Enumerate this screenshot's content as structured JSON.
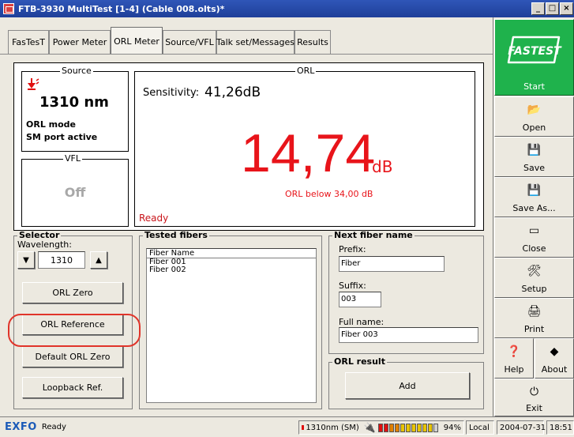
{
  "window": {
    "title": "FTB-3930 MultiTest [1-4] (Cable 008.olts)*",
    "controls": [
      "_",
      "□",
      "×"
    ]
  },
  "tabs": [
    {
      "label": "FasTesT"
    },
    {
      "label": "Power Meter"
    },
    {
      "label": "ORL Meter"
    },
    {
      "label": "Source/VFL"
    },
    {
      "label": "Talk set/Messages"
    },
    {
      "label": "Results"
    }
  ],
  "source": {
    "legend": "Source",
    "wavelength": "1310 nm",
    "mode": "ORL mode",
    "port": "SM port active"
  },
  "vfl": {
    "legend": "VFL",
    "state": "Off"
  },
  "orl": {
    "legend": "ORL",
    "sensitivity_label": "Sensitivity:",
    "sensitivity_value": "41,26dB",
    "value": "14,74",
    "unit": "dB",
    "note": "ORL below 34,00 dB",
    "status": "Ready"
  },
  "selector": {
    "legend": "Selector",
    "wavelength_label": "Wavelength:",
    "wavelength_value": "1310",
    "buttons": {
      "orl_zero": "ORL Zero",
      "orl_reference": "ORL Reference",
      "default_orl_zero": "Default ORL Zero",
      "loopback": "Loopback Ref."
    }
  },
  "tested_fibers": {
    "legend": "Tested fibers",
    "header": "Fiber Name",
    "items": [
      "Fiber 001",
      "Fiber 002"
    ]
  },
  "next_fiber": {
    "legend": "Next fiber name",
    "prefix_label": "Prefix:",
    "prefix_value": "Fiber",
    "suffix_label": "Suffix:",
    "suffix_value": "003",
    "fullname_label": "Full name:",
    "fullname_value": "Fiber 003"
  },
  "orl_result": {
    "legend": "ORL result",
    "add_label": "Add"
  },
  "right_panel": {
    "fastest_logo": "FASTEST",
    "start_label": "Start",
    "open_label": "Open",
    "save_label": "Save",
    "save_as_label": "Save As...",
    "close_label": "Close",
    "setup_label": "Setup",
    "print_label": "Print",
    "help_label": "Help",
    "about_label": "About",
    "exit_label": "Exit"
  },
  "statusbar": {
    "brand": "EXFO",
    "status": "Ready",
    "source_indicator": "1310nm (SM)",
    "battery_percent": "94%",
    "battery_level": 0.94,
    "mode": "Local",
    "date": "2004-07-31",
    "time": "18:51"
  },
  "colors": {
    "accent_red": "#e8141a",
    "fastest_green": "#1fb24c",
    "title_blue": "#1f3f99",
    "highlight": "#e0342a"
  }
}
